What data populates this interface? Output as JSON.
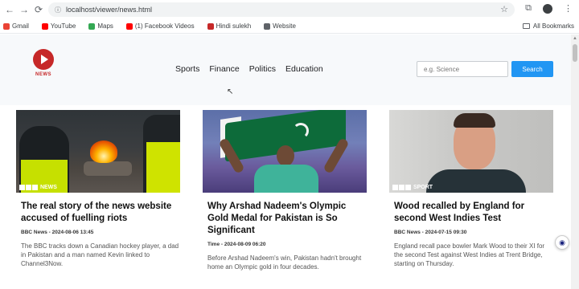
{
  "browser": {
    "url": "localhost/viewer/news.html",
    "bookmarks": [
      {
        "label": "Gmail",
        "color": "#ea4335"
      },
      {
        "label": "YouTube",
        "color": "#ff0000"
      },
      {
        "label": "Maps",
        "color": "#34a853"
      },
      {
        "label": "(1) Facebook Videos",
        "color": "#ff0000"
      },
      {
        "label": "Hindi sulekh",
        "color": "#c62828"
      },
      {
        "label": "Website",
        "color": "#5f6368"
      }
    ],
    "all_bookmarks": "All Bookmarks"
  },
  "header": {
    "logo_text": "NEWS",
    "nav": [
      "Sports",
      "Finance",
      "Politics",
      "Education"
    ],
    "search_placeholder": "e.g. Science",
    "search_button": "Search"
  },
  "cards": [
    {
      "tag": "NEWS",
      "title": "The real story of the news website accused of fuelling riots",
      "meta": "BBC News - 2024-08-06 13:45",
      "desc": "The BBC tracks down a Canadian hockey player, a dad in Pakistan and a man named Kevin linked to Channel3Now."
    },
    {
      "tag": "",
      "title": "Why Arshad Nadeem's Olympic Gold Medal for Pakistan is So Significant",
      "meta": "Time - 2024-08-09 06:20",
      "desc": "Before Arshad Nadeem's win, Pakistan hadn't brought home an Olympic gold in four decades."
    },
    {
      "tag": "SPORT",
      "title": "Wood recalled by England for second West Indies Test",
      "meta": "BBC News - 2024-07-15 09:30",
      "desc": "England recall pace bowler Mark Wood to their XI for the second Test against West Indies at Trent Bridge, starting on Thursday."
    }
  ]
}
